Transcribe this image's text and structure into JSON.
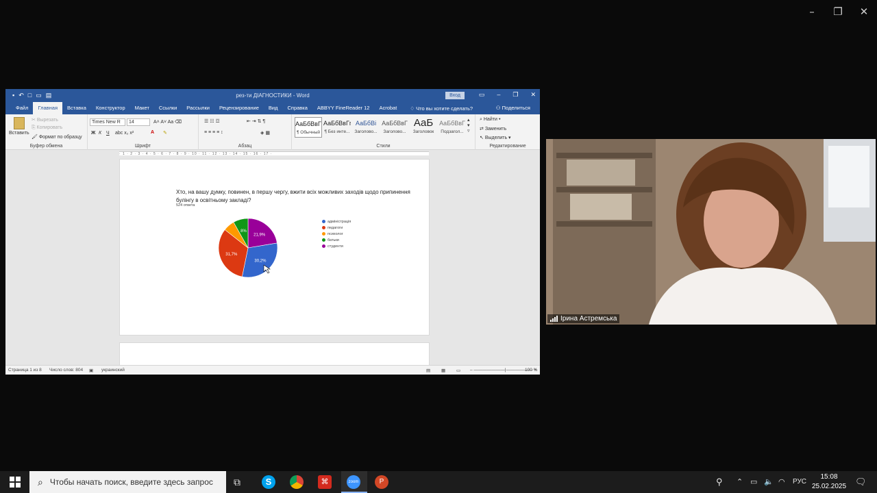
{
  "word": {
    "qat_undo": "↶",
    "title": "рез-ти ДІАГНОСТИКИ - Word",
    "signin": "Вход",
    "tabs": [
      "Файл",
      "Главная",
      "Вставка",
      "Конструктор",
      "Макет",
      "Ссылки",
      "Рассылки",
      "Рецензирование",
      "Вид",
      "Справка",
      "ABBYY FineReader 12",
      "Acrobat"
    ],
    "tell_me": "Что вы хотите сделать?",
    "share": "Поделиться",
    "ribbon": {
      "paste": "Вставить",
      "cut": "Вырезать",
      "copy": "Копировать",
      "format_painter": "Формат по образцу",
      "clipboard_label": "Буфер обмена",
      "font_name": "Times New R",
      "font_size": "14",
      "font_label": "Шрифт",
      "paragraph_label": "Абзац",
      "styles_label": "Стили",
      "styles": [
        {
          "sample": "АаБбВвГг,",
          "name": "¶ Обычный"
        },
        {
          "sample": "АаБбВвГг,",
          "name": "¶ Без инте..."
        },
        {
          "sample": "АаБбВі",
          "name": "Заголово..."
        },
        {
          "sample": "АаБбВвГ",
          "name": "Заголово..."
        },
        {
          "sample": "АаБ",
          "name": "Заголовок"
        },
        {
          "sample": "АаБбВвГ",
          "name": "Подзагол..."
        }
      ],
      "find": "Найти",
      "replace": "Заменить",
      "select": "Выделить",
      "editing_label": "Редактирование"
    },
    "document": {
      "question": "Хто, на вашу думку, повинен, в першу чергу, вжити всіх можливих заходів щодо припинення булінгу в освітньому закладі?",
      "answers": "524 ответа"
    },
    "status": {
      "page": "Страница 1 из 8",
      "words": "Число слов: 804",
      "language": "украинский",
      "zoom": "100 %"
    }
  },
  "chart_data": {
    "type": "pie",
    "categories": [
      "адміністрація",
      "педагоги",
      "психолог",
      "батьки",
      "студенти"
    ],
    "values": [
      30.2,
      31.7,
      6.1,
      8.0,
      21.9
    ],
    "labels": [
      "30,2%",
      "31,7%",
      "",
      "8%",
      "21,9%"
    ],
    "colors": [
      "#3366cc",
      "#dc3912",
      "#ff9900",
      "#109618",
      "#990099"
    ],
    "legend": "right"
  },
  "video": {
    "participant": "Ірина Астремська"
  },
  "taskbar": {
    "search_placeholder": "Чтобы начать поиск, введите здесь запрос",
    "lang": "РУС",
    "time": "15:08",
    "date": "25.02.2025"
  }
}
